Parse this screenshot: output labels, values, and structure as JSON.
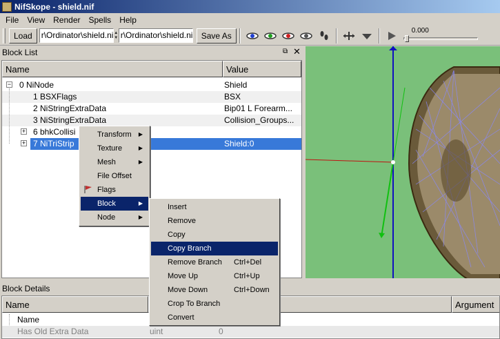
{
  "window": {
    "title": "NifSkope - shield.nif"
  },
  "menubar": [
    "File",
    "View",
    "Render",
    "Spells",
    "Help"
  ],
  "toolbar": {
    "load_label": "Load",
    "load_path": "r\\Ordinator\\shield.nif",
    "save_path": "r\\Ordinator\\shield.nif",
    "save_label": "Save As",
    "time_value": "0.000",
    "icons": [
      "view-eye-blue-icon",
      "view-eye-green-icon",
      "view-eye-red-icon",
      "view-eye-user-icon",
      "walk-icon",
      "move-axis-icon",
      "view-down-icon",
      "play-icon"
    ]
  },
  "block_list": {
    "title": "Block List",
    "col_name": "Name",
    "col_value": "Value",
    "rows": [
      {
        "name": "0  NiNode",
        "value": "Shield"
      },
      {
        "name": "1  BSXFlags",
        "value": "BSX"
      },
      {
        "name": "2  NiStringExtraData",
        "value": "Bip01 L Forearm..."
      },
      {
        "name": "3  NiStringExtraData",
        "value": "Collision_Groups..."
      },
      {
        "name": "6  bhkCollisi",
        "value": ""
      },
      {
        "name": "7  NiTriStrip",
        "value": "Shield:0"
      }
    ]
  },
  "context_menu": {
    "items": [
      {
        "label": "Transform",
        "submenu": true
      },
      {
        "label": "Texture",
        "submenu": true
      },
      {
        "label": "Mesh",
        "submenu": true
      },
      {
        "label": "File Offset",
        "submenu": false
      },
      {
        "label": "Flags",
        "submenu": false,
        "icon": "flags-icon"
      },
      {
        "label": "Block",
        "submenu": true,
        "highlighted": true
      },
      {
        "label": "Node",
        "submenu": true
      }
    ]
  },
  "block_submenu": {
    "items": [
      {
        "label": "Insert",
        "shortcut": ""
      },
      {
        "label": "Remove",
        "shortcut": ""
      },
      {
        "label": "Copy",
        "shortcut": ""
      },
      {
        "label": "Copy Branch",
        "shortcut": "",
        "highlighted": true
      },
      {
        "label": "Remove Branch",
        "shortcut": "Ctrl+Del"
      },
      {
        "label": "Move Up",
        "shortcut": "Ctrl+Up"
      },
      {
        "label": "Move Down",
        "shortcut": "Ctrl+Down"
      },
      {
        "label": "Crop To Branch",
        "shortcut": ""
      },
      {
        "label": "Convert",
        "shortcut": ""
      }
    ]
  },
  "block_details": {
    "title": "Block Details",
    "col_name": "Name",
    "col_argument": "Argument",
    "rows": [
      {
        "name": "Name",
        "type": "",
        "value": ""
      },
      {
        "name": "Has Old Extra Data",
        "type": "uint",
        "value": "0"
      }
    ]
  },
  "colors": {
    "selection": "#3879d9",
    "menu_highlight": "#0a246a",
    "viewport_bg": "#7ac07a",
    "title_start": "#0a246a"
  }
}
